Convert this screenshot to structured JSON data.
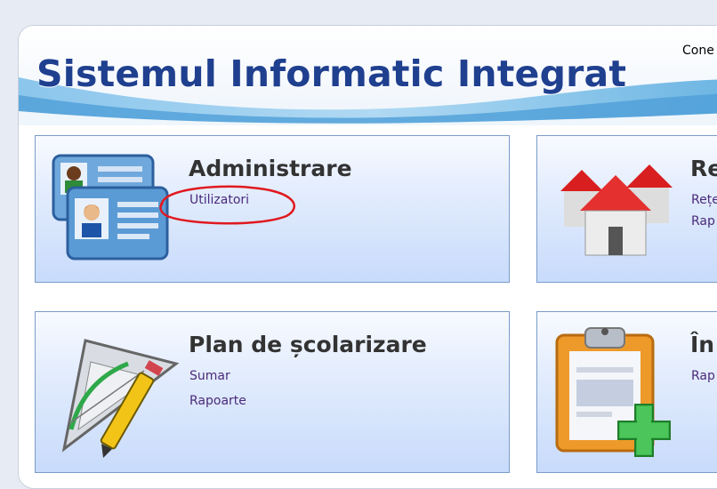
{
  "header": {
    "title": "Sistemul Informatic Integrat",
    "connection_text": "Cone"
  },
  "tiles": [
    {
      "heading": "Administrare",
      "links": [
        "Utilizatori"
      ],
      "icon": "id-cards-icon"
    },
    {
      "heading": "Re",
      "links": [
        "Rețe",
        "Rap"
      ],
      "icon": "houses-icon"
    },
    {
      "heading": "Plan de școlarizare",
      "links": [
        "Sumar",
        "Rapoarte"
      ],
      "icon": "drafting-tools-icon"
    },
    {
      "heading": "În",
      "links": [
        "Rap"
      ],
      "icon": "clipboard-add-icon"
    }
  ],
  "colors": {
    "title": "#1f3f8f",
    "tile_border": "#7b9cc9",
    "link": "#4a2a7a",
    "annotation": "#e0191f"
  }
}
